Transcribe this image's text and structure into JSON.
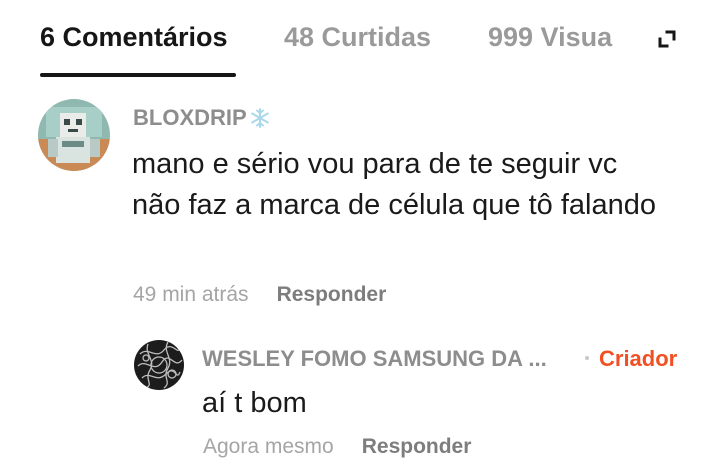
{
  "tabs": {
    "comments_label": "6 Comentários",
    "likes_label": "48 Curtidas",
    "views_label": "999 Visua"
  },
  "icons": {
    "expand": "expand-icon",
    "username_badge": "snowflake-icon"
  },
  "colors": {
    "active_tab": "#161616",
    "inactive_tab": "#9a9a9a",
    "creator_accent": "#f25022",
    "username": "#8d8d8d",
    "timestamp": "#a5a5a5"
  },
  "comment": {
    "username": "BLOXDRIP",
    "text": "mano e sério vou para de te seguir vc não faz a marca de célula que tô falando",
    "timestamp": "49 min atrás",
    "reply_label": "Responder"
  },
  "reply": {
    "username": "WESLEY FOMO SAMSUNG DA ...",
    "creator_label": "Criador",
    "text": "aí t bom",
    "timestamp": "Agora mesmo",
    "reply_label": "Responder"
  }
}
